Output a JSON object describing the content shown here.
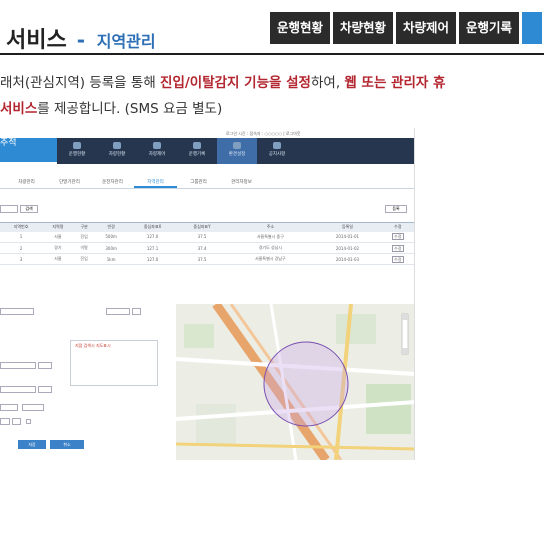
{
  "header": {
    "title": "서비스",
    "dash": "-",
    "subtitle": "지역관리",
    "tabs": [
      "운행현황",
      "차량현황",
      "차량제어",
      "운행기록"
    ]
  },
  "description": {
    "line1_a": "래처(관심지역) 등록을 통해 ",
    "line1_b": "진입/이탈감지 기능을 설정",
    "line1_c": "하여, ",
    "line1_d": "웹 또는 관리자 휴",
    "line2_a": "서비스",
    "line2_b": "를 제공합니다. (SMS 요금 별도)"
  },
  "screenshot": {
    "logo": "추적",
    "topbar_text": "로그인 시간 : 접속자 : ○○○○○ | 로그아웃",
    "nav": [
      "운행현황",
      "차량현황",
      "차량제어",
      "운행기록",
      "환경설정",
      "공지사항"
    ],
    "nav_active": 4,
    "subtabs": [
      "차량관리",
      "단말기관리",
      "운전자관리",
      "지역관리",
      "그룹관리",
      "관리자정보"
    ],
    "subtab_active": 3,
    "search_button": "검색",
    "register_button": "등록",
    "table_headers": [
      "지역번호",
      "지역명",
      "구분",
      "반경",
      "중심좌표X",
      "중심좌표Y",
      "주소",
      "등록일",
      "수정"
    ],
    "table_rows": [
      [
        "1",
        "서울",
        "진입",
        "500m",
        "127.0",
        "37.5",
        "서울특별시 중구",
        "2014-01-01",
        "수정"
      ],
      [
        "2",
        "경기",
        "이탈",
        "300m",
        "127.1",
        "37.4",
        "경기도 성남시",
        "2014-01-02",
        "수정"
      ],
      [
        "3",
        "서울",
        "진입",
        "1km",
        "127.0",
        "37.5",
        "서울특별시 강남구",
        "2014-01-03",
        "수정"
      ]
    ],
    "form_memo": "지점 검색시 지도표시",
    "form_buttons": [
      "저장",
      "취소"
    ]
  }
}
